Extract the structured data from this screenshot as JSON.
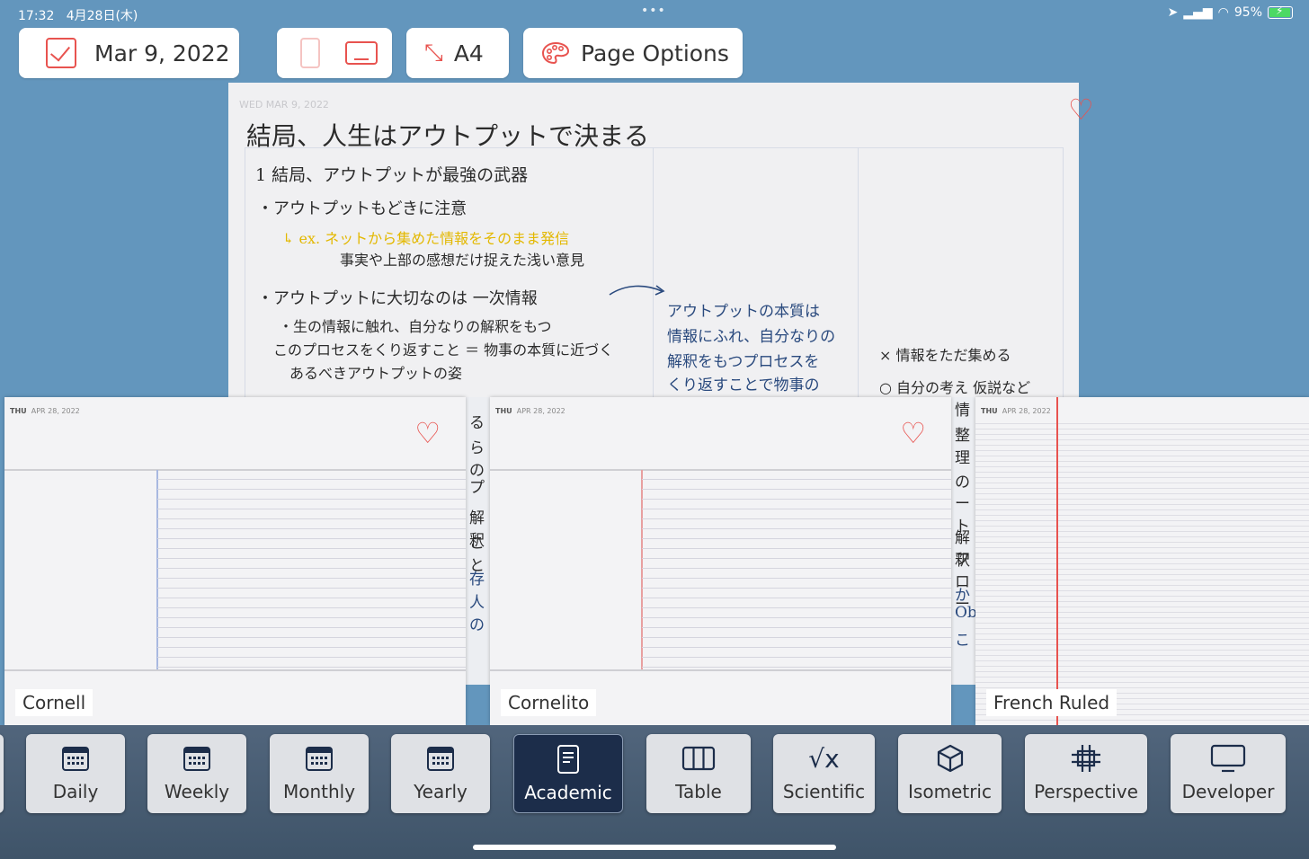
{
  "status": {
    "time": "17:32",
    "date": "4月28日(木)",
    "dots": "•••",
    "battery": "95%"
  },
  "toolbar": {
    "date_label": "Mar 9, 2022",
    "size_label": "A4",
    "options_label": "Page Options"
  },
  "note": {
    "date": "WED  MAR 9, 2022",
    "title": "結局、人生はアウトプットで決まる",
    "heading": "1 結局、アウトプットが最強の武器",
    "lines": [
      "・アウトプットもどきに注意",
      "↳ ex. ネットから集めた情報をそのまま発信",
      "事実や上部の感想だけ捉えた浅い意見",
      "・アウトプットに大切なのは 一次情報",
      "・生の情報に触れ、自分なりの解釈をもつ",
      "このプロセスをくり返すこと ＝ 物事の本質に近づく",
      "あるべきアウトプットの姿"
    ],
    "middle": [
      "アウトプットの本質は",
      "情報にふれ、自分なりの",
      "解釈をもつプロセスを",
      "くり返すことで物事の"
    ],
    "right": [
      "× 情報をただ集める",
      "○ 自分の考え 仮説など"
    ]
  },
  "cards": [
    {
      "label": "Cornell",
      "day": "THU",
      "date": "APR 28, 2022"
    },
    {
      "label": "Cornelito",
      "day": "THU",
      "date": "APR 28, 2022"
    },
    {
      "label": "French Ruled",
      "day": "THU",
      "date": "APR 28, 2022"
    }
  ],
  "tabs": [
    {
      "label": "Daily",
      "icon": "calendar-icon"
    },
    {
      "label": "Weekly",
      "icon": "calendar-icon"
    },
    {
      "label": "Monthly",
      "icon": "calendar-icon"
    },
    {
      "label": "Yearly",
      "icon": "calendar-icon"
    },
    {
      "label": "Academic",
      "icon": "document-icon",
      "active": true
    },
    {
      "label": "Table",
      "icon": "columns-icon"
    },
    {
      "label": "Scientific",
      "icon": "sqrt-icon"
    },
    {
      "label": "Isometric",
      "icon": "cube-icon"
    },
    {
      "label": "Perspective",
      "icon": "perspective-icon"
    },
    {
      "label": "Developer",
      "icon": "monitor-icon"
    }
  ],
  "colors": {
    "accent": "#e8534f",
    "background": "#6396bd",
    "active_tab": "#1c2d4a"
  }
}
